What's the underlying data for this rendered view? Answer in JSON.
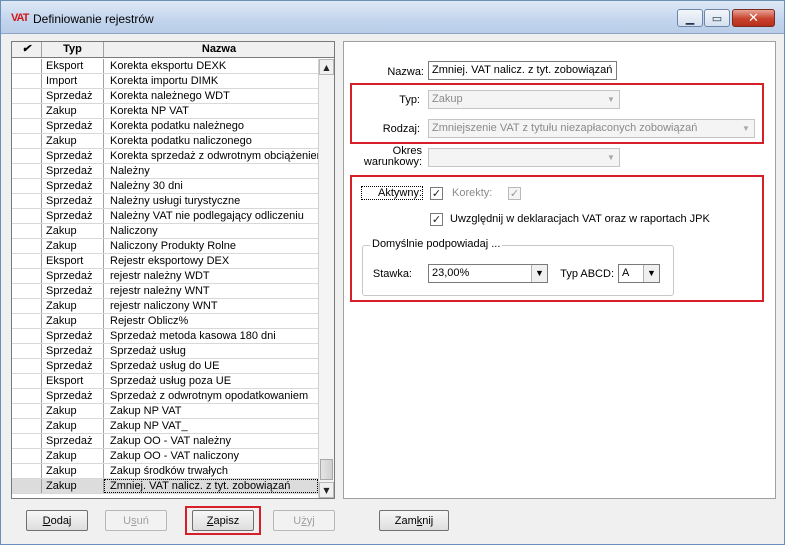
{
  "window": {
    "app_icon_text": "VAT",
    "title": "Definiowanie rejestrów",
    "minimize_glyph": "▁",
    "maximize_glyph": "▭",
    "close_glyph": "✕"
  },
  "grid": {
    "header": {
      "check": "✔",
      "typ": "Typ",
      "nazwa": "Nazwa"
    },
    "rows": [
      {
        "typ": "Eksport",
        "nazwa": "Korekta eksportu DEXK"
      },
      {
        "typ": "Import",
        "nazwa": "Korekta importu DIMK"
      },
      {
        "typ": "Sprzedaż",
        "nazwa": "Korekta należnego WDT"
      },
      {
        "typ": "Zakup",
        "nazwa": "Korekta NP VAT"
      },
      {
        "typ": "Sprzedaż",
        "nazwa": "Korekta podatku należnego"
      },
      {
        "typ": "Zakup",
        "nazwa": "Korekta podatku naliczonego"
      },
      {
        "typ": "Sprzedaż",
        "nazwa": "Korekta sprzedaż z odwrotnym obciążeniem"
      },
      {
        "typ": "Sprzedaż",
        "nazwa": "Należny"
      },
      {
        "typ": "Sprzedaż",
        "nazwa": "Należny 30 dni"
      },
      {
        "typ": "Sprzedaż",
        "nazwa": "Należny usługi turystyczne"
      },
      {
        "typ": "Sprzedaż",
        "nazwa": "Należny VAT nie podlegający odliczeniu"
      },
      {
        "typ": "Zakup",
        "nazwa": "Naliczony"
      },
      {
        "typ": "Zakup",
        "nazwa": "Naliczony Produkty Rolne"
      },
      {
        "typ": "Eksport",
        "nazwa": "Rejestr eksportowy DEX"
      },
      {
        "typ": "Sprzedaż",
        "nazwa": "rejestr należny WDT"
      },
      {
        "typ": "Sprzedaż",
        "nazwa": "rejestr należny WNT"
      },
      {
        "typ": "Zakup",
        "nazwa": "rejestr naliczony WNT"
      },
      {
        "typ": "Zakup",
        "nazwa": "Rejestr Oblicz%"
      },
      {
        "typ": "Sprzedaż",
        "nazwa": "Sprzedaż metoda kasowa 180 dni"
      },
      {
        "typ": "Sprzedaż",
        "nazwa": "Sprzedaż usług"
      },
      {
        "typ": "Sprzedaż",
        "nazwa": "Sprzedaż usług do UE"
      },
      {
        "typ": "Eksport",
        "nazwa": "Sprzedaż usług poza UE"
      },
      {
        "typ": "Sprzedaż",
        "nazwa": "Sprzedaż z odwrotnym opodatkowaniem"
      },
      {
        "typ": "Zakup",
        "nazwa": "Zakup NP VAT"
      },
      {
        "typ": "Zakup",
        "nazwa": "Zakup NP VAT_"
      },
      {
        "typ": "Sprzedaż",
        "nazwa": "Zakup OO - VAT należny"
      },
      {
        "typ": "Zakup",
        "nazwa": "Zakup OO - VAT naliczony"
      },
      {
        "typ": "Zakup",
        "nazwa": "Zakup środków trwałych"
      },
      {
        "typ": "Zakup",
        "nazwa": "Zmniej. VAT nalicz. z tyt. zobowiązań"
      }
    ],
    "selected_index": 28
  },
  "form": {
    "nazwa_label": "Nazwa:",
    "nazwa_value": "Zmniej. VAT nalicz. z tyt. zobowiązań",
    "typ_label": "Typ:",
    "typ_value": "Zakup",
    "rodzaj_label": "Rodzaj:",
    "rodzaj_value": "Zmniejszenie VAT z tytułu niezapłaconych zobowiązań",
    "okres_label_line1": "Okres",
    "okres_label_line2": "warunkowy:",
    "okres_value": "",
    "aktywny_label": "Aktywny:",
    "aktywny_checked": true,
    "korekty_label": "Korekty:",
    "korekty_checked": true,
    "uwzglednij_label": "Uwzględnij w deklaracjach VAT oraz w raportach JPK",
    "uwzglednij_checked": true,
    "group_title": "Domyślnie podpowiadaj ...",
    "stawka_label": "Stawka:",
    "stawka_value": "23,00%",
    "typ_abcd_label": "Typ ABCD:",
    "typ_abcd_value": "A"
  },
  "buttons": {
    "dodaj": {
      "mnemonic": "D",
      "rest": "odaj"
    },
    "usun": {
      "pre": "U",
      "mnemonic": "s",
      "rest": "uń"
    },
    "zapisz": {
      "mnemonic": "Z",
      "rest": "apisz"
    },
    "uzyj": {
      "pre": "U",
      "mnemonic": "ż",
      "rest": "yj"
    },
    "zamknij": {
      "pre": "Zam",
      "mnemonic": "k",
      "rest": "nij"
    }
  },
  "colors": {
    "highlight_red": "#d5202a",
    "title_gradient_top": "#dfe9f5",
    "close_button": "#c8412c"
  },
  "icons": {
    "app": "vat-logo-icon",
    "check_column": "checkmark-icon",
    "combo_arrow": "chevron-down-icon"
  }
}
